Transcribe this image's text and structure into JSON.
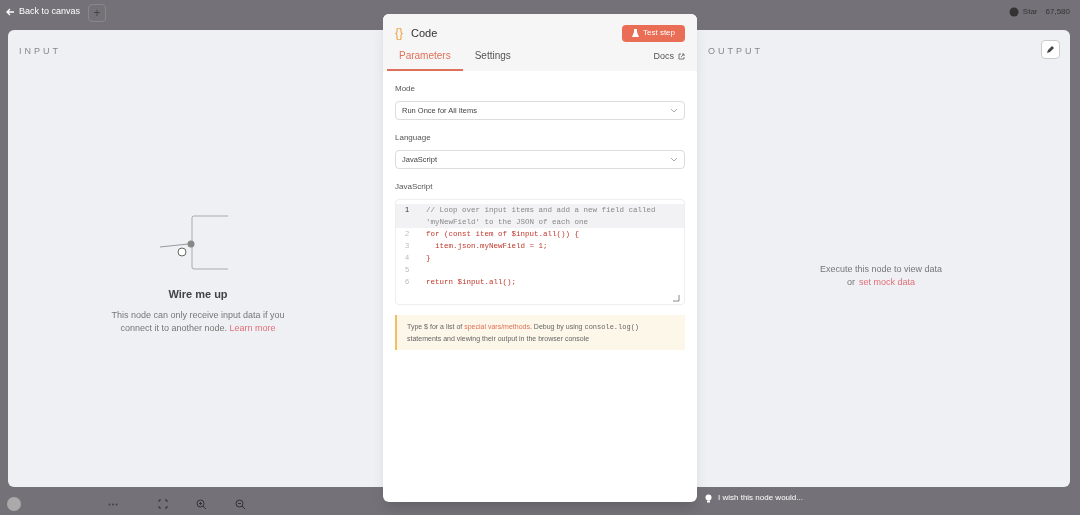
{
  "top_bar": {
    "back_link": "Back to canvas",
    "add_button": "+",
    "github": {
      "label": "Star",
      "count": "67,580"
    }
  },
  "input_panel": {
    "title": "INPUT",
    "empty_title": "Wire me up",
    "empty_text": "This node can only receive input data if you connect it to another node.",
    "learn_more": "Learn more"
  },
  "node_dialog": {
    "icon": "{}",
    "title": "Code",
    "test_button": "Test step",
    "tabs": [
      {
        "label": "Parameters",
        "selected": true
      },
      {
        "label": "Settings",
        "selected": false
      }
    ],
    "docs_link": "Docs",
    "fields": [
      {
        "label": "Mode",
        "value": "Run Once for All Items"
      },
      {
        "label": "Language",
        "value": "JavaScript"
      }
    ],
    "code": {
      "label": "JavaScript",
      "lines": [
        {
          "number": "1",
          "text": "// Loop over input items and add a new field called 'myNewField' to the JSON of each one",
          "kind": "comment",
          "active": true
        },
        {
          "number": "2",
          "text": "for (const item of $input.all()) {",
          "kind": "code",
          "active": false
        },
        {
          "number": "3",
          "text": "  item.json.myNewField = 1;",
          "kind": "code",
          "active": false
        },
        {
          "number": "4",
          "text": "}",
          "kind": "code",
          "active": false
        },
        {
          "number": "5",
          "kind": "code",
          "active": false
        },
        {
          "number": "6",
          "text": "return $input.all();",
          "kind": "code",
          "active": false
        }
      ]
    },
    "hint_parts": [
      {
        "kind": "text",
        "text": "Type $ for a list of "
      },
      {
        "kind": "link",
        "text": "special vars/methods"
      },
      {
        "kind": "text",
        "text": ". Debug by using "
      },
      {
        "kind": "code",
        "text": "console.log()"
      },
      {
        "kind": "text",
        "text": " statements and viewing their output in the browser console"
      }
    ],
    "feedback": "I wish this node would..."
  },
  "output_panel": {
    "title": "OUTPUT",
    "empty_text": "Execute this node to view data",
    "or": "or",
    "mock_link": "set mock data"
  }
}
